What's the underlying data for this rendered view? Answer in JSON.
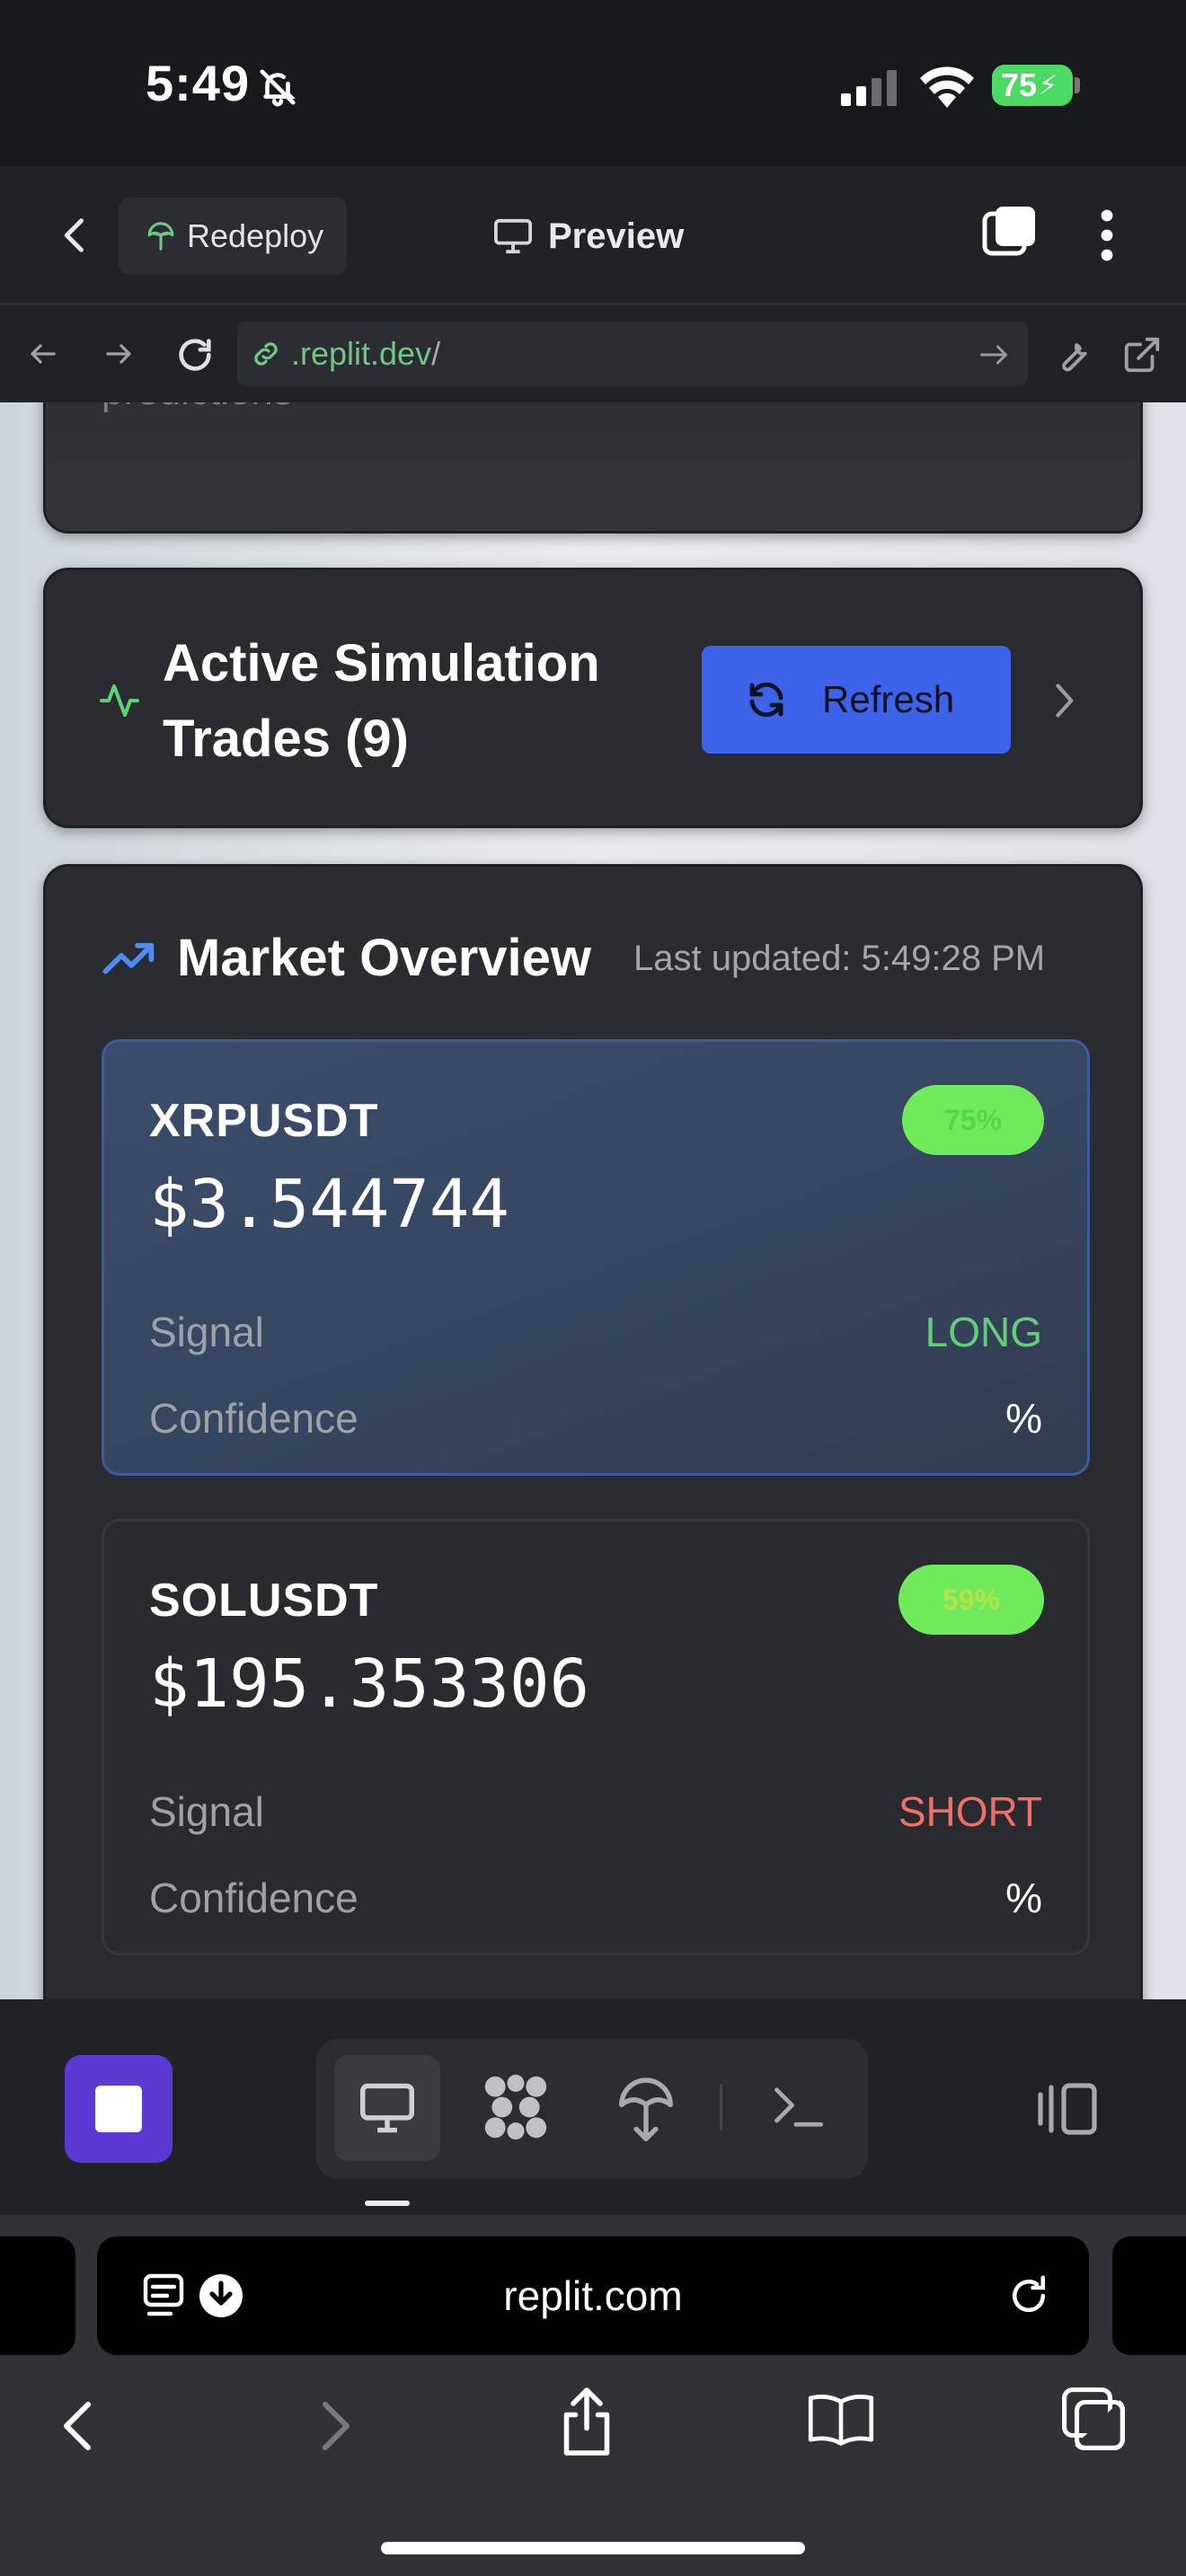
{
  "status_bar": {
    "time": "5:49",
    "battery": "75"
  },
  "replit_header": {
    "redeploy_label": "Redeploy",
    "preview_label": "Preview"
  },
  "url_bar": {
    "domain": ".replit.dev",
    "path": "/"
  },
  "content": {
    "previous_card_text": "predictions",
    "trades": {
      "title": "Active Simulation Trades (9)",
      "refresh_label": "Refresh"
    },
    "market": {
      "title": "Market Overview",
      "last_updated": "Last updated: 5:49:28 PM",
      "coins": [
        {
          "symbol": "XRPUSDT",
          "price": "$3.544744",
          "badge": "75%",
          "signal_label": "Signal",
          "signal_value": "LONG",
          "signal_color": "#5fcf78",
          "confidence_label": "Confidence",
          "confidence_value": "%"
        },
        {
          "symbol": "SOLUSDT",
          "price": "$195.353306",
          "badge": "59%",
          "signal_label": "Signal",
          "signal_value": "SHORT",
          "signal_color": "#f06f66",
          "confidence_label": "Confidence",
          "confidence_value": "%"
        }
      ]
    }
  },
  "safari": {
    "address": "replit.com"
  },
  "colors": {
    "accent_blue": "#3d63ea",
    "stop_purple": "#5b3ad4",
    "badge_green": "#6fea5a"
  }
}
